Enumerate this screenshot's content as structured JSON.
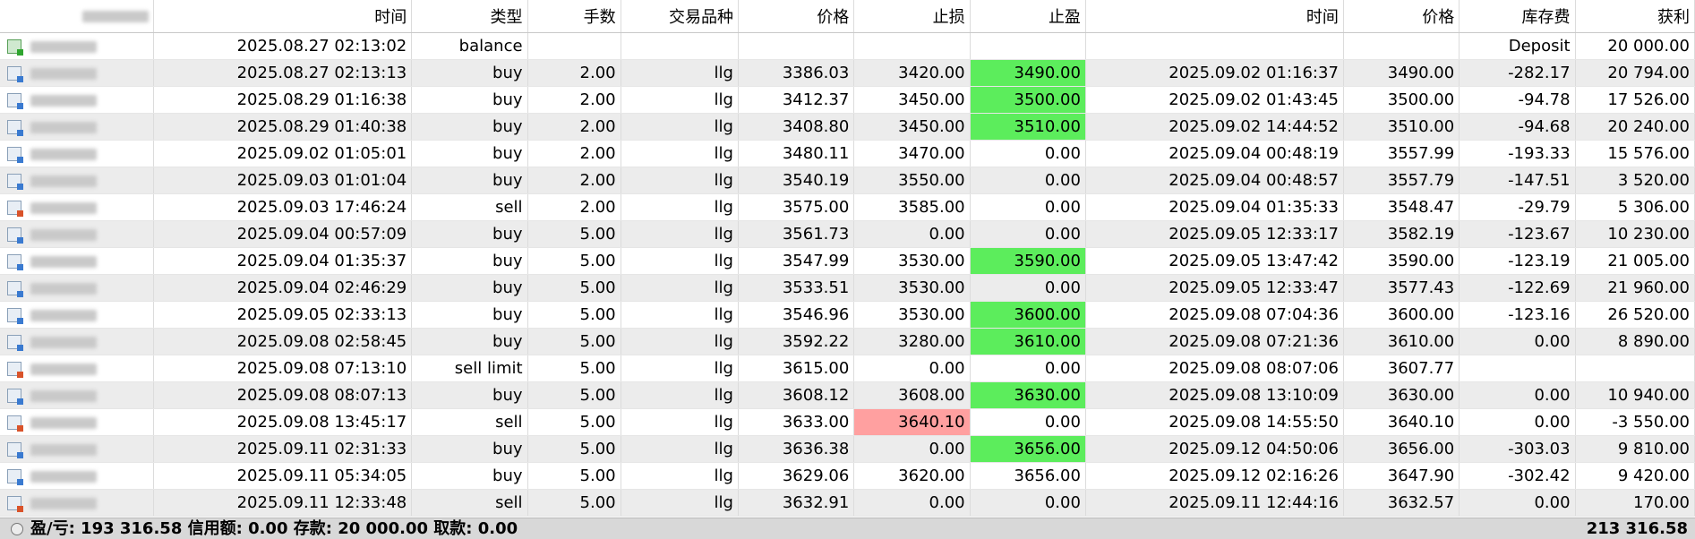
{
  "columns": [
    "",
    "时间",
    "类型",
    "手数",
    "交易品种",
    "价格",
    "止损",
    "止盈",
    "时间",
    "价格",
    "库存费",
    "获利"
  ],
  "rows": [
    {
      "kind": "balance",
      "time": "2025.08.27 02:13:02",
      "type": "balance",
      "volume": "",
      "symbol": "",
      "price": "",
      "sl": "",
      "tp": "",
      "close_time": "",
      "close_price": "",
      "swap": "Deposit",
      "profit": "20 000.00"
    },
    {
      "kind": "buy",
      "time": "2025.08.27 02:13:13",
      "type": "buy",
      "volume": "2.00",
      "symbol": "llg",
      "price": "3386.03",
      "sl": "3420.00",
      "tp": "3490.00",
      "tp_hl": "green",
      "close_time": "2025.09.02 01:16:37",
      "close_price": "3490.00",
      "swap": "-282.17",
      "profit": "20 794.00"
    },
    {
      "kind": "buy",
      "time": "2025.08.29 01:16:38",
      "type": "buy",
      "volume": "2.00",
      "symbol": "llg",
      "price": "3412.37",
      "sl": "3450.00",
      "tp": "3500.00",
      "tp_hl": "green",
      "close_time": "2025.09.02 01:43:45",
      "close_price": "3500.00",
      "swap": "-94.78",
      "profit": "17 526.00"
    },
    {
      "kind": "buy",
      "time": "2025.08.29 01:40:38",
      "type": "buy",
      "volume": "2.00",
      "symbol": "llg",
      "price": "3408.80",
      "sl": "3450.00",
      "tp": "3510.00",
      "tp_hl": "green",
      "close_time": "2025.09.02 14:44:52",
      "close_price": "3510.00",
      "swap": "-94.68",
      "profit": "20 240.00"
    },
    {
      "kind": "buy",
      "time": "2025.09.02 01:05:01",
      "type": "buy",
      "volume": "2.00",
      "symbol": "llg",
      "price": "3480.11",
      "sl": "3470.00",
      "tp": "0.00",
      "close_time": "2025.09.04 00:48:19",
      "close_price": "3557.99",
      "swap": "-193.33",
      "profit": "15 576.00"
    },
    {
      "kind": "buy",
      "time": "2025.09.03 01:01:04",
      "type": "buy",
      "volume": "2.00",
      "symbol": "llg",
      "price": "3540.19",
      "sl": "3550.00",
      "tp": "0.00",
      "close_time": "2025.09.04 00:48:57",
      "close_price": "3557.79",
      "swap": "-147.51",
      "profit": "3 520.00"
    },
    {
      "kind": "sell",
      "time": "2025.09.03 17:46:24",
      "type": "sell",
      "volume": "2.00",
      "symbol": "llg",
      "price": "3575.00",
      "sl": "3585.00",
      "tp": "0.00",
      "close_time": "2025.09.04 01:35:33",
      "close_price": "3548.47",
      "swap": "-29.79",
      "profit": "5 306.00"
    },
    {
      "kind": "buy",
      "time": "2025.09.04 00:57:09",
      "type": "buy",
      "volume": "5.00",
      "symbol": "llg",
      "price": "3561.73",
      "sl": "0.00",
      "tp": "0.00",
      "close_time": "2025.09.05 12:33:17",
      "close_price": "3582.19",
      "swap": "-123.67",
      "profit": "10 230.00"
    },
    {
      "kind": "buy",
      "time": "2025.09.04 01:35:37",
      "type": "buy",
      "volume": "5.00",
      "symbol": "llg",
      "price": "3547.99",
      "sl": "3530.00",
      "tp": "3590.00",
      "tp_hl": "green",
      "close_time": "2025.09.05 13:47:42",
      "close_price": "3590.00",
      "swap": "-123.19",
      "profit": "21 005.00"
    },
    {
      "kind": "buy",
      "time": "2025.09.04 02:46:29",
      "type": "buy",
      "volume": "5.00",
      "symbol": "llg",
      "price": "3533.51",
      "sl": "3530.00",
      "tp": "0.00",
      "close_time": "2025.09.05 12:33:47",
      "close_price": "3577.43",
      "swap": "-122.69",
      "profit": "21 960.00"
    },
    {
      "kind": "buy",
      "time": "2025.09.05 02:33:13",
      "type": "buy",
      "volume": "5.00",
      "symbol": "llg",
      "price": "3546.96",
      "sl": "3530.00",
      "tp": "3600.00",
      "tp_hl": "green",
      "close_time": "2025.09.08 07:04:36",
      "close_price": "3600.00",
      "swap": "-123.16",
      "profit": "26 520.00"
    },
    {
      "kind": "buy",
      "time": "2025.09.08 02:58:45",
      "type": "buy",
      "volume": "5.00",
      "symbol": "llg",
      "price": "3592.22",
      "sl": "3280.00",
      "tp": "3610.00",
      "tp_hl": "green",
      "close_time": "2025.09.08 07:21:36",
      "close_price": "3610.00",
      "swap": "0.00",
      "profit": "8 890.00"
    },
    {
      "kind": "sell",
      "time": "2025.09.08 07:13:10",
      "type": "sell limit",
      "volume": "5.00",
      "symbol": "llg",
      "price": "3615.00",
      "sl": "0.00",
      "tp": "0.00",
      "close_time": "2025.09.08 08:07:06",
      "close_price": "3607.77",
      "swap": "",
      "profit": ""
    },
    {
      "kind": "buy",
      "time": "2025.09.08 08:07:13",
      "type": "buy",
      "volume": "5.00",
      "symbol": "llg",
      "price": "3608.12",
      "sl": "3608.00",
      "tp": "3630.00",
      "tp_hl": "green",
      "close_time": "2025.09.08 13:10:09",
      "close_price": "3630.00",
      "swap": "0.00",
      "profit": "10 940.00"
    },
    {
      "kind": "sell",
      "time": "2025.09.08 13:45:17",
      "type": "sell",
      "volume": "5.00",
      "symbol": "llg",
      "price": "3633.00",
      "sl": "3640.10",
      "sl_hl": "red",
      "tp": "0.00",
      "close_time": "2025.09.08 14:55:50",
      "close_price": "3640.10",
      "swap": "0.00",
      "profit": "-3 550.00"
    },
    {
      "kind": "buy",
      "time": "2025.09.11 02:31:33",
      "type": "buy",
      "volume": "5.00",
      "symbol": "llg",
      "price": "3636.38",
      "sl": "0.00",
      "tp": "3656.00",
      "tp_hl": "green",
      "close_time": "2025.09.12 04:50:06",
      "close_price": "3656.00",
      "swap": "-303.03",
      "profit": "9 810.00"
    },
    {
      "kind": "buy",
      "time": "2025.09.11 05:34:05",
      "type": "buy",
      "volume": "5.00",
      "symbol": "llg",
      "price": "3629.06",
      "sl": "3620.00",
      "tp": "3656.00",
      "close_time": "2025.09.12 02:16:26",
      "close_price": "3647.90",
      "swap": "-302.42",
      "profit": "9 420.00"
    },
    {
      "kind": "sell",
      "time": "2025.09.11 12:33:48",
      "type": "sell",
      "volume": "5.00",
      "symbol": "llg",
      "price": "3632.91",
      "sl": "0.00",
      "tp": "0.00",
      "close_time": "2025.09.11 12:44:16",
      "close_price": "3632.57",
      "swap": "0.00",
      "profit": "170.00"
    }
  ],
  "footer": {
    "summary": "盈/亏: 193 316.58  信用额: 0.00  存款: 20 000.00  取款: 0.00",
    "total": "213 316.58"
  },
  "colors": {
    "tp_hit": "#5ced5c",
    "sl_hit": "#ffa0a0",
    "row_alt": "#ececec"
  }
}
